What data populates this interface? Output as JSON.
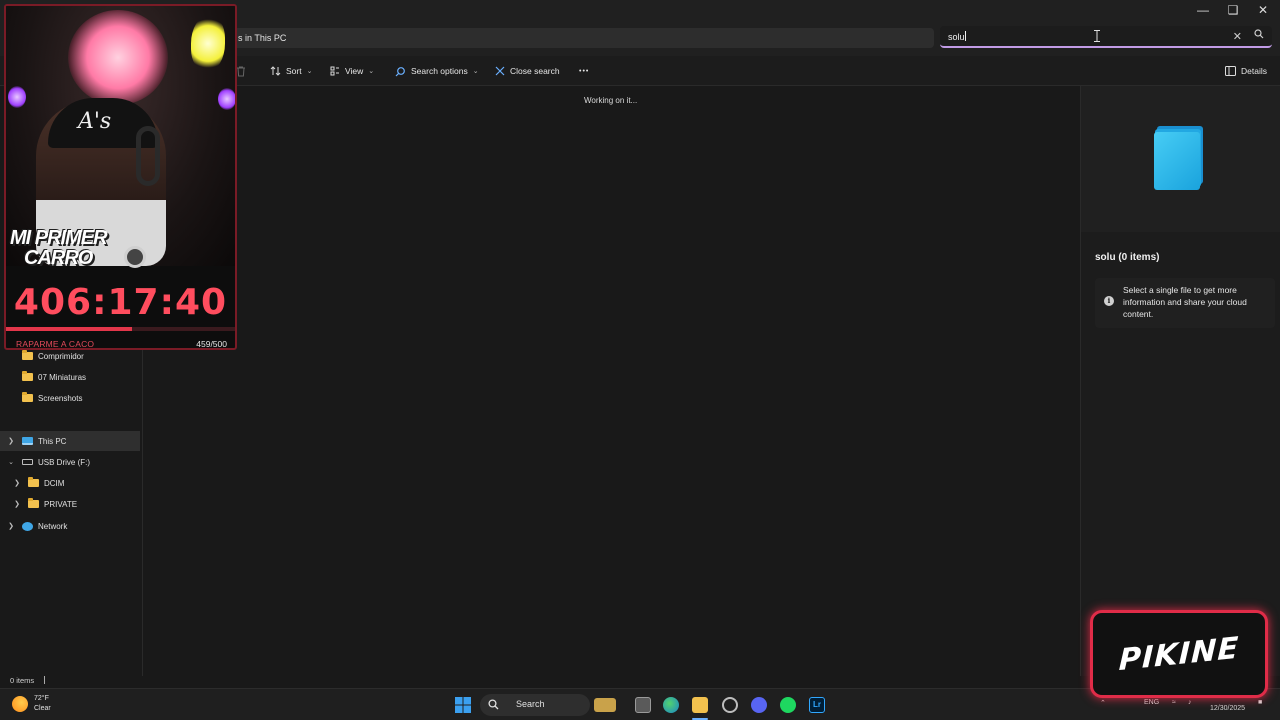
{
  "explorer": {
    "address_text": "s in This PC",
    "search_value": "solu",
    "toolbar": {
      "sort": "Sort",
      "view": "View",
      "search_options": "Search options",
      "close_search": "Close search",
      "more": "•••",
      "details": "Details"
    },
    "status_message": "Working on it...",
    "nav": {
      "items": [
        {
          "label": "Comprimidor"
        },
        {
          "label": "07 Miniaturas"
        },
        {
          "label": "Screenshots"
        },
        {
          "label": "This PC"
        },
        {
          "label": "USB Drive (F:)"
        },
        {
          "label": "DCIM"
        },
        {
          "label": "PRIVATE"
        },
        {
          "label": "Network"
        }
      ]
    },
    "details_pane": {
      "title": "solu (0 items)",
      "info": "Select a single file to get more information and share your cloud content."
    },
    "status_bar": "0 items"
  },
  "taskbar": {
    "weather_temp": "72°F",
    "weather_cond": "Clear",
    "search_label": "Search",
    "language": "ENG",
    "date": "12/30/2025"
  },
  "stream_overlay": {
    "banner": "MI PRIMER",
    "banner2": "CARRO",
    "timer": "406:17:40",
    "goal_label": "RAPARME A CACO",
    "goal_count": "459/500",
    "goal_progress": 0.918,
    "logo": "PIKINE",
    "accent": "#e2364a"
  }
}
